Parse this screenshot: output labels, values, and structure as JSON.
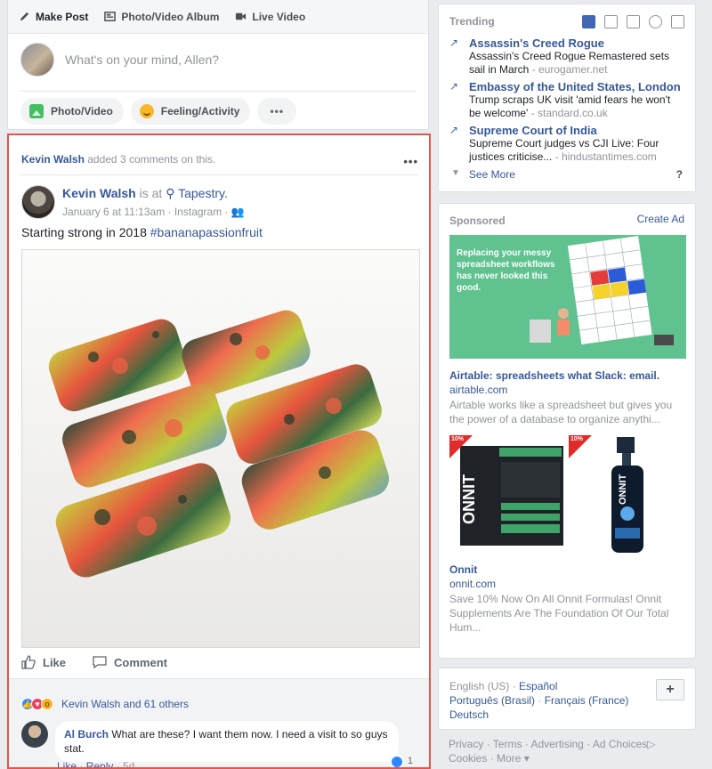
{
  "composer": {
    "tabs": [
      {
        "label": "Make Post",
        "icon": "pencil-icon"
      },
      {
        "label": "Photo/Video Album",
        "icon": "album-icon"
      },
      {
        "label": "Live Video",
        "icon": "video-camera-icon"
      }
    ],
    "placeholder": "What's on your mind, Allen?",
    "buttons": [
      {
        "label": "Photo/Video",
        "icon": "photo-icon"
      },
      {
        "label": "Feeling/Activity",
        "icon": "smiley-icon"
      },
      {
        "label": "•••",
        "icon": "more-icon"
      }
    ]
  },
  "post": {
    "header_name": "Kevin Walsh",
    "header_action": " added 3 comments on this.",
    "more": "•••",
    "author": "Kevin Walsh",
    "is_at": " is at ",
    "place": "Tapestry.",
    "meta": "January 6 at 11:13am · Instagram · ",
    "text": "Starting strong in 2018 ",
    "hashtag": "#bananapassionfruit",
    "like_label": "Like",
    "comment_label": "Comment",
    "reactions_text": "Kevin Walsh and 61 others",
    "comment": {
      "name": "Al Burch",
      "text": " What are these? I want them now. I need a visit to so guys stat.",
      "likes": "1",
      "like": "Like",
      "reply": "Reply",
      "time": "5d"
    }
  },
  "trending": {
    "title": "Trending",
    "items": [
      {
        "title": "Assassin's Creed Rogue",
        "desc": "Assassin's Creed Rogue Remastered sets sail in March",
        "source": " - eurogamer.net"
      },
      {
        "title": "Embassy of the United States, London",
        "desc": "Trump scraps UK visit 'amid fears he won't be welcome'",
        "source": " - standard.co.uk"
      },
      {
        "title": "Supreme Court of India",
        "desc": "Supreme Court judges vs CJI Live: Four justices criticise...",
        "source": " - hindustantimes.com"
      }
    ],
    "see_more": "See More",
    "help": "?"
  },
  "sponsored": {
    "title": "Sponsored",
    "create_ad": "Create Ad",
    "ad1": {
      "image_text": "Replacing your messy spreadsheet workflows has never looked this good.",
      "title": "Airtable: spreadsheets what Slack: email.",
      "url": "airtable.com",
      "desc": "Airtable works like a spreadsheet but gives you the power of a database to organize anythi..."
    },
    "ad2": {
      "badge": "10%",
      "title": "Onnit",
      "url": "onnit.com",
      "desc": "Save 10% Now On All Onnit Formulas! Onnit Supplements Are The Foundation Of Our Total Hum...",
      "brand": "ONNIT"
    }
  },
  "footer": {
    "current_lang": "English (US)",
    "sep": " · ",
    "languages": [
      "Español",
      "Português (Brasil)",
      "Français (France)",
      "Deutsch"
    ],
    "add": "+",
    "legal": [
      "Privacy",
      "Terms",
      "Advertising",
      "Ad Choices",
      "Cookies",
      "More"
    ]
  }
}
